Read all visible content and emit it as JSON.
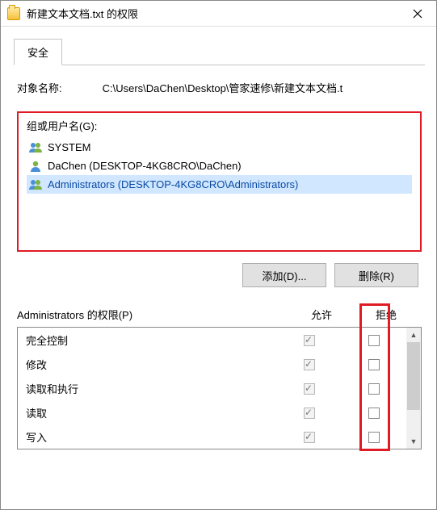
{
  "window": {
    "title": "新建文本文档.txt 的权限"
  },
  "tab": {
    "security": "安全"
  },
  "object": {
    "label": "对象名称:",
    "value": "C:\\Users\\DaChen\\Desktop\\管家速修\\新建文本文档.t"
  },
  "group": {
    "label": "组或用户名(G):",
    "users": [
      {
        "display": "SYSTEM",
        "type": "group",
        "selected": false
      },
      {
        "display": "DaChen (DESKTOP-4KG8CRO\\DaChen)",
        "type": "user",
        "selected": false
      },
      {
        "display": "Administrators (DESKTOP-4KG8CRO\\Administrators)",
        "type": "group",
        "selected": true
      }
    ]
  },
  "buttons": {
    "add": "添加(D)...",
    "remove": "删除(R)"
  },
  "perm": {
    "title": "Administrators 的权限(P)",
    "allow": "允许",
    "deny": "拒绝",
    "rows": [
      {
        "name": "完全控制",
        "allow_checked": true,
        "allow_disabled": true,
        "deny_checked": false
      },
      {
        "name": "修改",
        "allow_checked": true,
        "allow_disabled": true,
        "deny_checked": false
      },
      {
        "name": "读取和执行",
        "allow_checked": true,
        "allow_disabled": true,
        "deny_checked": false
      },
      {
        "name": "读取",
        "allow_checked": true,
        "allow_disabled": true,
        "deny_checked": false
      },
      {
        "name": "写入",
        "allow_checked": true,
        "allow_disabled": true,
        "deny_checked": false
      }
    ]
  }
}
